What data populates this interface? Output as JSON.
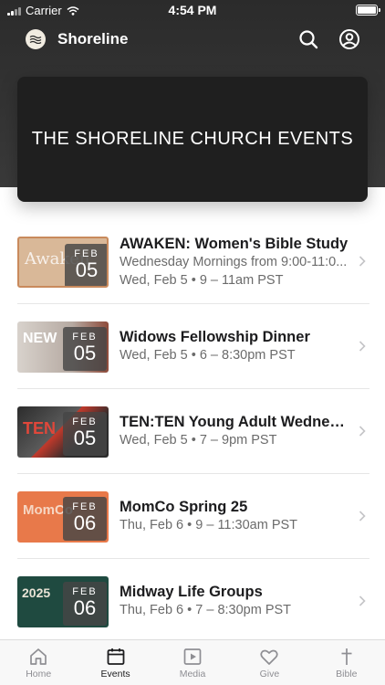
{
  "status": {
    "carrier": "Carrier",
    "time": "4:54 PM"
  },
  "app": {
    "title": "Shoreline"
  },
  "banner": {
    "title": "THE SHORELINE CHURCH EVENTS"
  },
  "events": [
    {
      "title": "AWAKEN: Women's Bible Study",
      "subtitle": "Wednesday Mornings from 9:00-11:0...",
      "when": "Wed, Feb 5 • 9 – 11am PST",
      "month": "FEB",
      "day": "05",
      "thumb_color": "#d9b898",
      "thumb_text": "Awaken"
    },
    {
      "title": "Widows Fellowship Dinner",
      "subtitle": "",
      "when": "Wed, Feb 5 • 6 – 8:30pm PST",
      "month": "FEB",
      "day": "05",
      "thumb_color": "#c9c3bd",
      "thumb_text": "NEW"
    },
    {
      "title": "TEN:TEN Young Adult Wednes...",
      "subtitle": "",
      "when": "Wed, Feb 5 • 7 – 9pm PST",
      "month": "FEB",
      "day": "05",
      "thumb_color": "#3a3a3a",
      "thumb_text": "TEN"
    },
    {
      "title": "MomCo Spring 25",
      "subtitle": "",
      "when": "Thu, Feb 6 • 9 – 11:30am PST",
      "month": "FEB",
      "day": "06",
      "thumb_color": "#e8794a",
      "thumb_text": "MomCo"
    },
    {
      "title": "Midway Life Groups",
      "subtitle": "",
      "when": "Thu, Feb 6 • 7 – 8:30pm PST",
      "month": "FEB",
      "day": "06",
      "thumb_color": "#1f4a40",
      "thumb_text": "2025"
    }
  ],
  "tabs": [
    {
      "label": "Home",
      "icon": "home-icon",
      "active": false
    },
    {
      "label": "Events",
      "icon": "calendar-icon",
      "active": true
    },
    {
      "label": "Media",
      "icon": "play-icon",
      "active": false
    },
    {
      "label": "Give",
      "icon": "heart-icon",
      "active": false
    },
    {
      "label": "Bible",
      "icon": "cross-icon",
      "active": false
    }
  ]
}
